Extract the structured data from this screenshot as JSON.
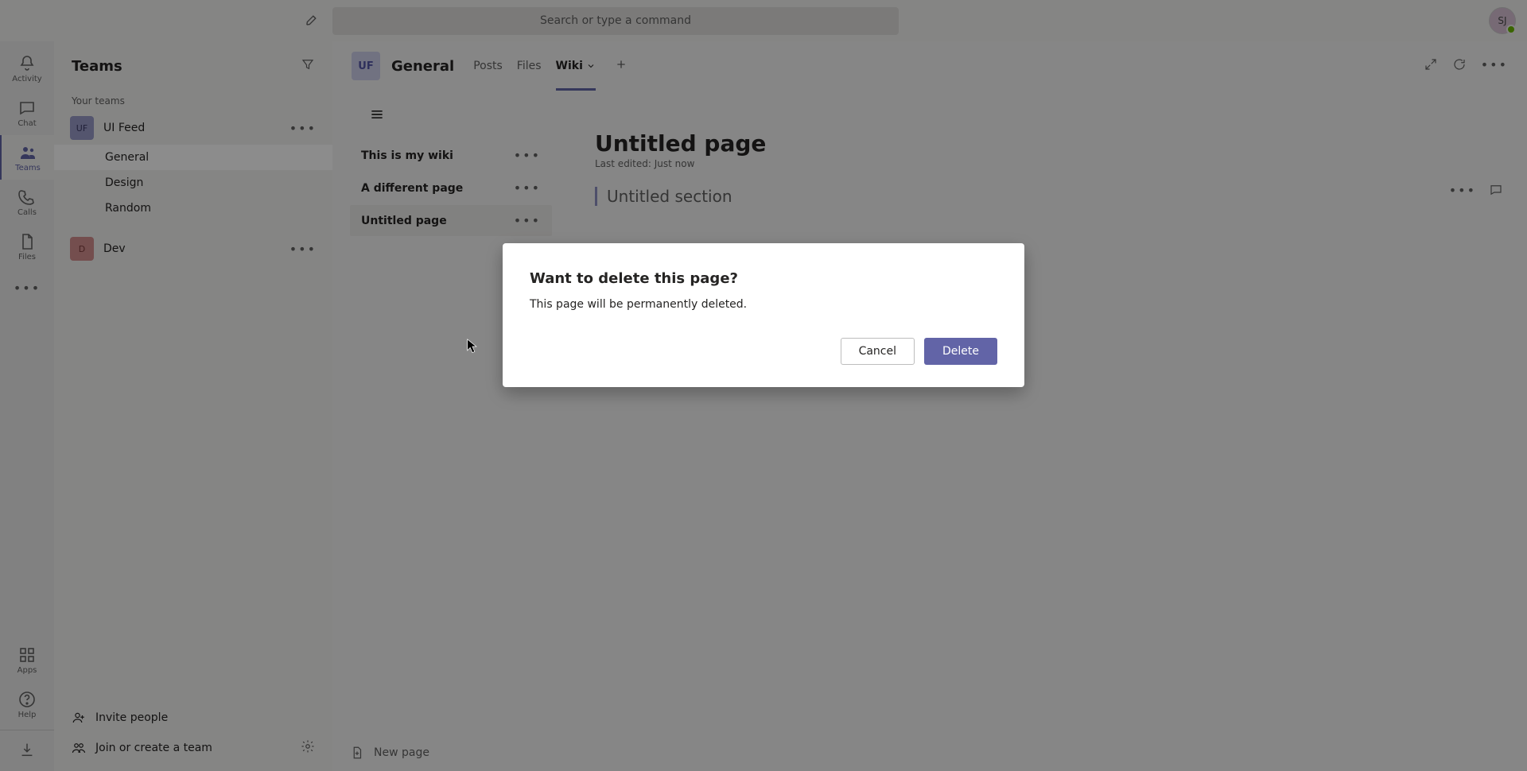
{
  "titlebar": {
    "search_placeholder": "Search or type a command",
    "avatar_initials": "SJ"
  },
  "rail": {
    "activity": "Activity",
    "chat": "Chat",
    "teams": "Teams",
    "calls": "Calls",
    "files": "Files",
    "apps": "Apps",
    "help": "Help"
  },
  "teams_panel": {
    "title": "Teams",
    "section_label": "Your teams",
    "teams": [
      {
        "initials": "UF",
        "name": "UI Feed",
        "channels": [
          "General",
          "Design",
          "Random"
        ]
      },
      {
        "initials": "D",
        "name": "Dev",
        "channels": []
      }
    ],
    "invite_label": "Invite people",
    "join_label": "Join or create a team"
  },
  "channel": {
    "avatar_initials": "UF",
    "name": "General",
    "tabs": {
      "posts": "Posts",
      "files": "Files",
      "wiki": "Wiki"
    }
  },
  "wiki": {
    "pages": [
      {
        "title": "This is my wiki"
      },
      {
        "title": "A different page"
      },
      {
        "title": "Untitled page"
      }
    ],
    "new_page_label": "New page",
    "editor": {
      "title": "Untitled page",
      "last_edited": "Last edited: Just now",
      "section_placeholder": "Untitled section"
    }
  },
  "modal": {
    "title": "Want to delete this page?",
    "body": "This page will be permanently deleted.",
    "cancel": "Cancel",
    "delete": "Delete"
  }
}
